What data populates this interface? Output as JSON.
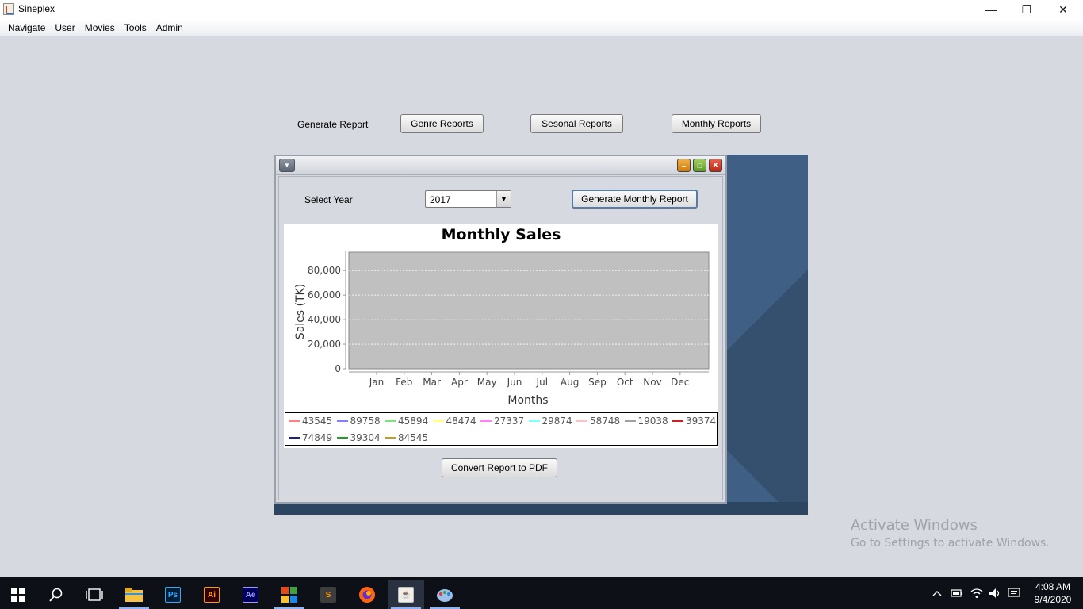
{
  "window": {
    "title": "Sineplex",
    "minimize_glyph": "—",
    "restore_glyph": "❐",
    "close_glyph": "✕"
  },
  "menubar": {
    "items": [
      "Navigate",
      "User",
      "Movies",
      "Tools",
      "Admin"
    ]
  },
  "report_bar": {
    "label": "Generate Report",
    "genre_button": "Genre Reports",
    "seasonal_button": "Sesonal Reports",
    "monthly_button": "Monthly Reports"
  },
  "monthly_frame": {
    "select_year_label": "Select Year",
    "year_value": "2017",
    "generate_button": "Generate Monthly Report",
    "convert_button": "Convert Report to PDF"
  },
  "chart_data": {
    "type": "line",
    "title": "Monthly Sales",
    "xlabel": "Months",
    "ylabel": "Sales (TK)",
    "categories": [
      "Jan",
      "Feb",
      "Mar",
      "Apr",
      "May",
      "Jun",
      "Jul",
      "Aug",
      "Sep",
      "Oct",
      "Nov",
      "Dec"
    ],
    "ylim": [
      0,
      95000
    ],
    "yticks": [
      0,
      20000,
      40000,
      60000,
      80000
    ],
    "ytick_labels": [
      "0",
      "20,000",
      "40,000",
      "60,000",
      "80,000"
    ],
    "grid": true,
    "plot_background": "#c0c0c0",
    "legend_position": "bottom",
    "series": [
      {
        "name": "43545",
        "color": "#ff8080"
      },
      {
        "name": "89758",
        "color": "#8080ff"
      },
      {
        "name": "45894",
        "color": "#80e080"
      },
      {
        "name": "48474",
        "color": "#ffff80"
      },
      {
        "name": "27337",
        "color": "#ff80ff"
      },
      {
        "name": "29874",
        "color": "#80ffff"
      },
      {
        "name": "58748",
        "color": "#ffc0c0"
      },
      {
        "name": "19038",
        "color": "#a0a0a0"
      },
      {
        "name": "39374",
        "color": "#cc2020"
      },
      {
        "name": "74849",
        "color": "#202080"
      },
      {
        "name": "39304",
        "color": "#20a020"
      },
      {
        "name": "84545",
        "color": "#c0a020"
      }
    ]
  },
  "watermark": {
    "line1": "Activate Windows",
    "line2": "Go to Settings to activate Windows."
  },
  "taskbar": {
    "apps": [
      {
        "name": "start-icon",
        "color": "#ffffff"
      },
      {
        "name": "search-icon",
        "color": "#ffffff"
      },
      {
        "name": "task-view-icon",
        "color": "#ffffff"
      },
      {
        "name": "file-explorer-icon",
        "color": "#f5c242"
      },
      {
        "name": "photoshop-icon",
        "color": "#31a8ff",
        "text": "Ps"
      },
      {
        "name": "illustrator-icon",
        "color": "#ff9a00",
        "text": "Ai"
      },
      {
        "name": "after-effects-icon",
        "color": "#9999ff",
        "text": "Ae"
      },
      {
        "name": "app-tiles-icon",
        "color": "#e64a19"
      },
      {
        "name": "sublime-text-icon",
        "color": "#ff9800",
        "text": "S"
      },
      {
        "name": "firefox-icon",
        "color": "#ff6611"
      },
      {
        "name": "java-icon",
        "color": "#e8e8e8"
      },
      {
        "name": "paint-icon",
        "color": "#9cc0e8"
      }
    ],
    "clock_time": "4:08 AM",
    "clock_date": "9/4/2020"
  }
}
